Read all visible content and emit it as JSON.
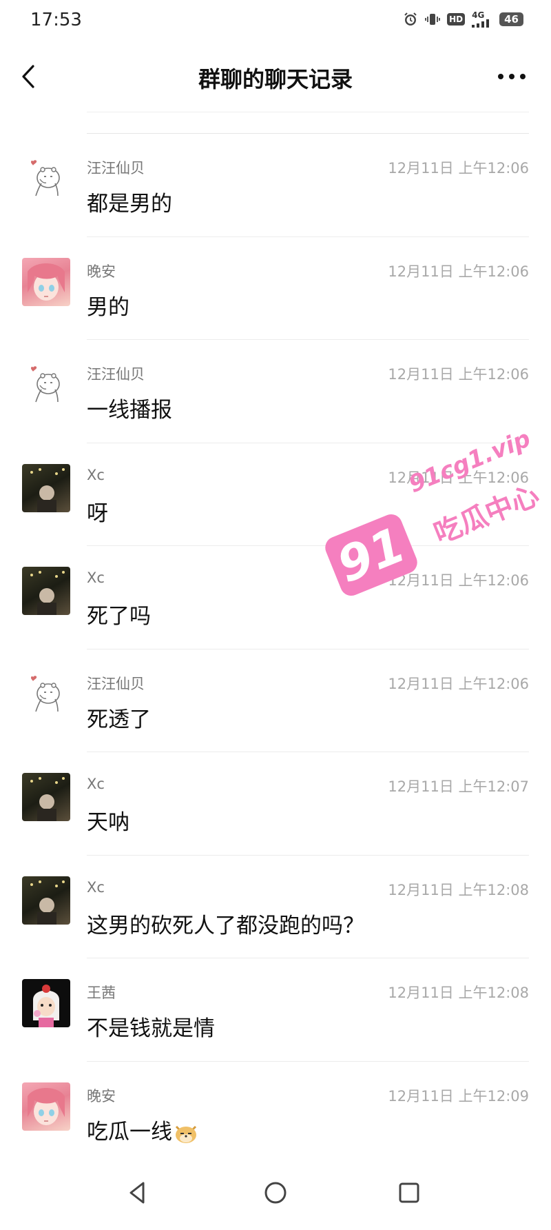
{
  "status_bar": {
    "time": "17:53",
    "network": "4G",
    "hd_label": "HD",
    "battery": "46",
    "icons": [
      "alarm-icon",
      "vibrate-icon",
      "hd-icon",
      "signal-icon",
      "battery-icon"
    ]
  },
  "header": {
    "title": "群聊的聊天记录",
    "back_icon": "chevron-left-icon",
    "more_icon": "more-dots-icon"
  },
  "messages": [
    {
      "sender": "汪汪仙贝",
      "time": "12月11日 上午12:06",
      "content": "都是男的",
      "avatar": "bear-avatar"
    },
    {
      "sender": "晚安",
      "time": "12月11日 上午12:06",
      "content": "男的",
      "avatar": "anime-avatar"
    },
    {
      "sender": "汪汪仙贝",
      "time": "12月11日 上午12:06",
      "content": "一线播报",
      "avatar": "bear-avatar"
    },
    {
      "sender": "Xc",
      "time": "12月11日 上午12:06",
      "content": "呀",
      "avatar": "xc-avatar"
    },
    {
      "sender": "Xc",
      "time": "12月11日 上午12:06",
      "content": "死了吗",
      "avatar": "xc-avatar"
    },
    {
      "sender": "汪汪仙贝",
      "time": "12月11日 上午12:06",
      "content": "死透了",
      "avatar": "bear-avatar"
    },
    {
      "sender": "Xc",
      "time": "12月11日 上午12:07",
      "content": "天呐",
      "avatar": "xc-avatar"
    },
    {
      "sender": "Xc",
      "time": "12月11日 上午12:08",
      "content": "这男的砍死人了都没跑的吗？",
      "avatar": "xc-avatar"
    },
    {
      "sender": "王茜",
      "time": "12月11日 上午12:08",
      "content": "不是钱就是情",
      "avatar": "wang-avatar"
    },
    {
      "sender": "晚安",
      "time": "12月11日 上午12:09",
      "content": "吃瓜一线",
      "avatar": "anime-avatar",
      "emoji": "doge-emoji"
    }
  ],
  "watermark": {
    "number": "91",
    "url": "91cg1.vip",
    "brand": "吃瓜中心",
    "color": "#f57fbf"
  },
  "nav_bar": {
    "icons": [
      "nav-back-icon",
      "nav-home-icon",
      "nav-recents-icon"
    ]
  }
}
